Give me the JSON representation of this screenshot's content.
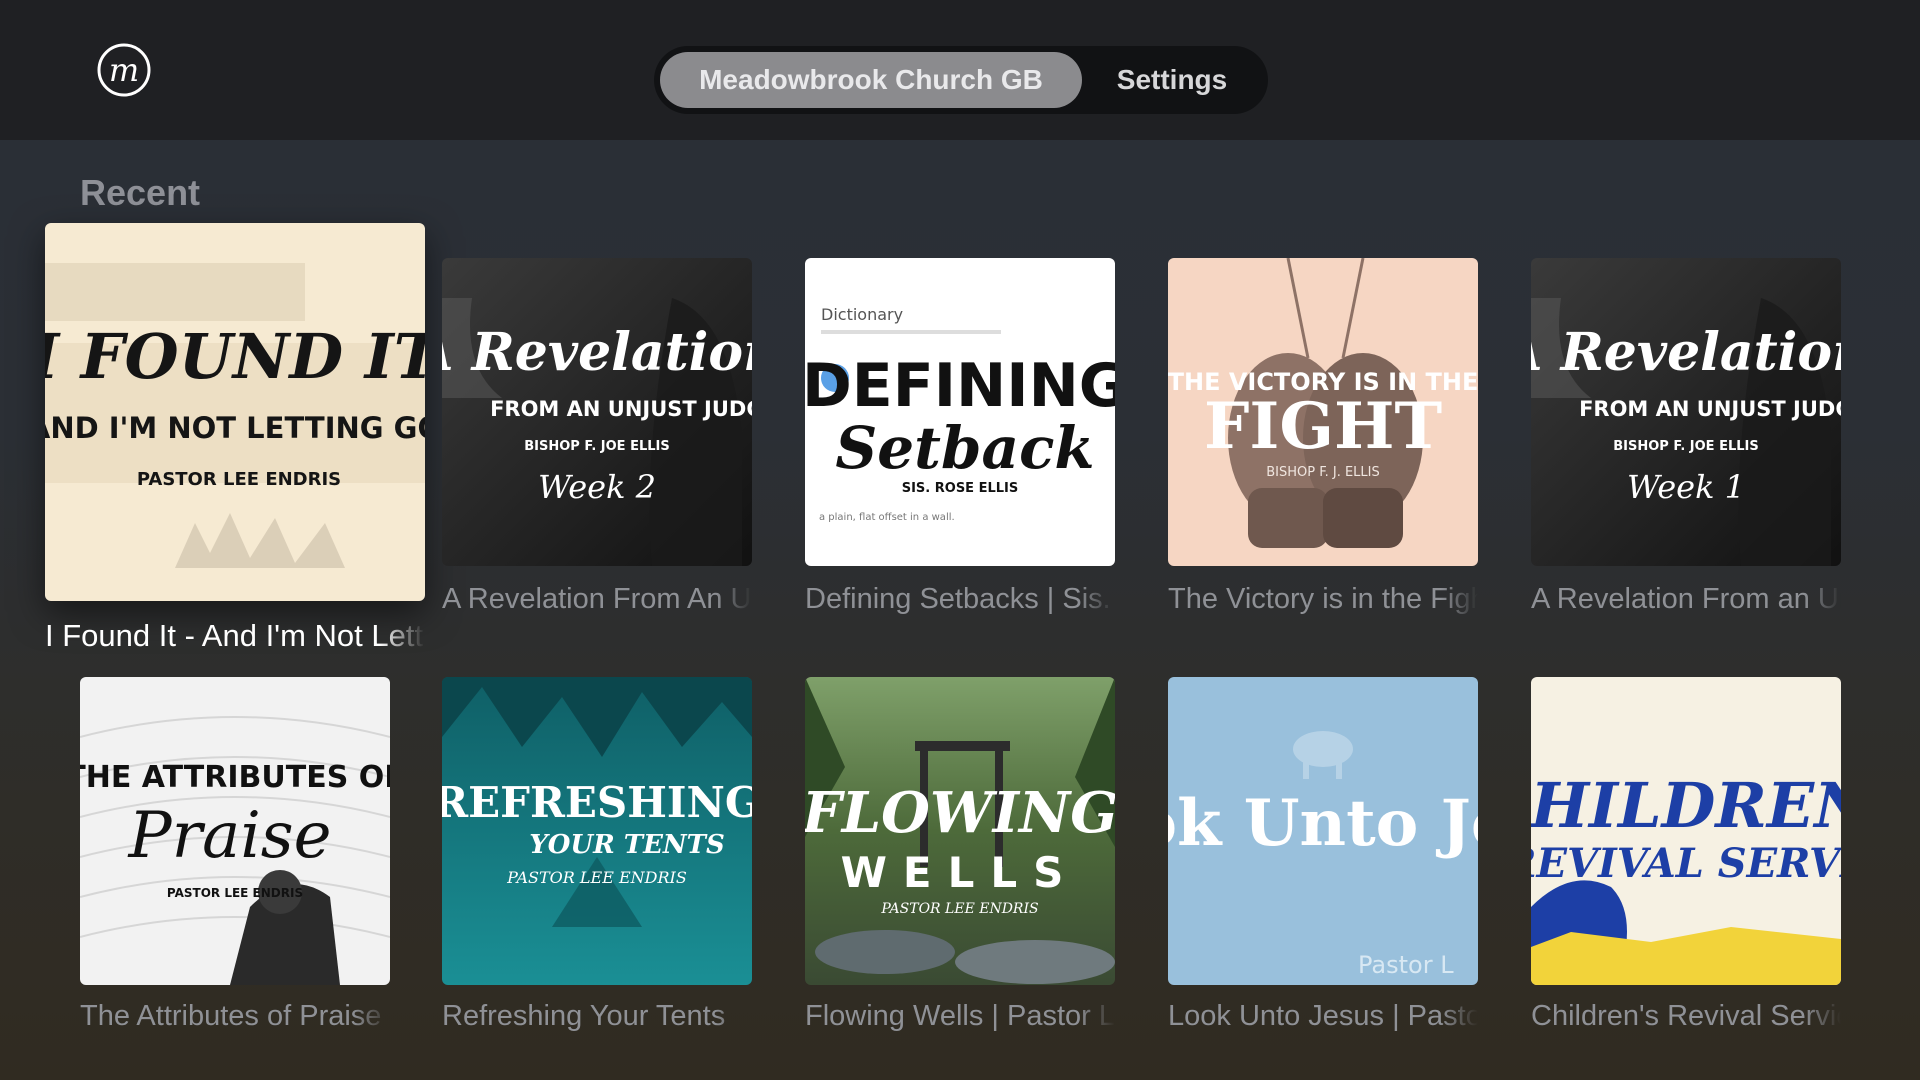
{
  "header": {
    "logo_letter": "m",
    "tabs": [
      {
        "label": "Meadowbrook Church GB",
        "active": true
      },
      {
        "label": "Settings",
        "active": false
      }
    ]
  },
  "section": {
    "title": "Recent"
  },
  "cards": [
    {
      "caption": "I Found It - And I'm Not Letting Go",
      "focused": true,
      "art": {
        "bg": "#f6ead2",
        "lines": [
          "I FOUND IT",
          "AND I'M NOT LETTING GO",
          "PASTOR LEE ENDRIS"
        ]
      }
    },
    {
      "caption": "A Revelation From An Unjust Judge",
      "art": {
        "bg": "#2b2b2b",
        "lines": [
          "A Revelation",
          "FROM AN UNJUST JUDGE",
          "BISHOP F. JOE ELLIS",
          "Week 2"
        ]
      }
    },
    {
      "caption": "Defining Setbacks | Sis. Rose Ellis",
      "art": {
        "bg": "#ffffff",
        "lines": [
          "Dictionary",
          "DEFINING",
          "Setback",
          "SIS. ROSE ELLIS",
          "a plain, flat offset in a wall."
        ]
      }
    },
    {
      "caption": "The Victory is in the Fight",
      "art": {
        "bg": "#f6d6c3",
        "lines": [
          "THE VICTORY IS IN THE",
          "FIGHT",
          "BISHOP F. J. ELLIS"
        ]
      }
    },
    {
      "caption": "A Revelation From an Unjust Judge",
      "art": {
        "bg": "#2b2b2b",
        "lines": [
          "A Revelation",
          "FROM AN UNJUST JUDGE",
          "BISHOP F. JOE ELLIS",
          "Week 1"
        ]
      }
    },
    {
      "caption": "The Attributes of Praise",
      "art": {
        "bg": "#f2f2f2",
        "lines": [
          "THE ATTRIBUTES OF",
          "Praise",
          "PASTOR LEE ENDRIS"
        ]
      }
    },
    {
      "caption": "Refreshing Your Tents",
      "art": {
        "bg": "#137b82",
        "lines": [
          "REFRESHING",
          "YOUR TENTS",
          "PASTOR LEE ENDRIS"
        ]
      }
    },
    {
      "caption": "Flowing Wells | Pastor Lee Endris",
      "art": {
        "bg": "#4f6a3c",
        "lines": [
          "FLOWING",
          "WELLS",
          "PASTOR LEE ENDRIS"
        ]
      }
    },
    {
      "caption": "Look Unto Jesus | Pastor Lee Endris",
      "art": {
        "bg": "#99c0dc",
        "lines": [
          "ok Unto Je",
          "Pastor L"
        ]
      }
    },
    {
      "caption": "Children's Revival Service",
      "art": {
        "bg": "#f6f1e3",
        "lines": [
          "CHILDREN",
          "REVIVAL SERVI"
        ]
      }
    }
  ]
}
